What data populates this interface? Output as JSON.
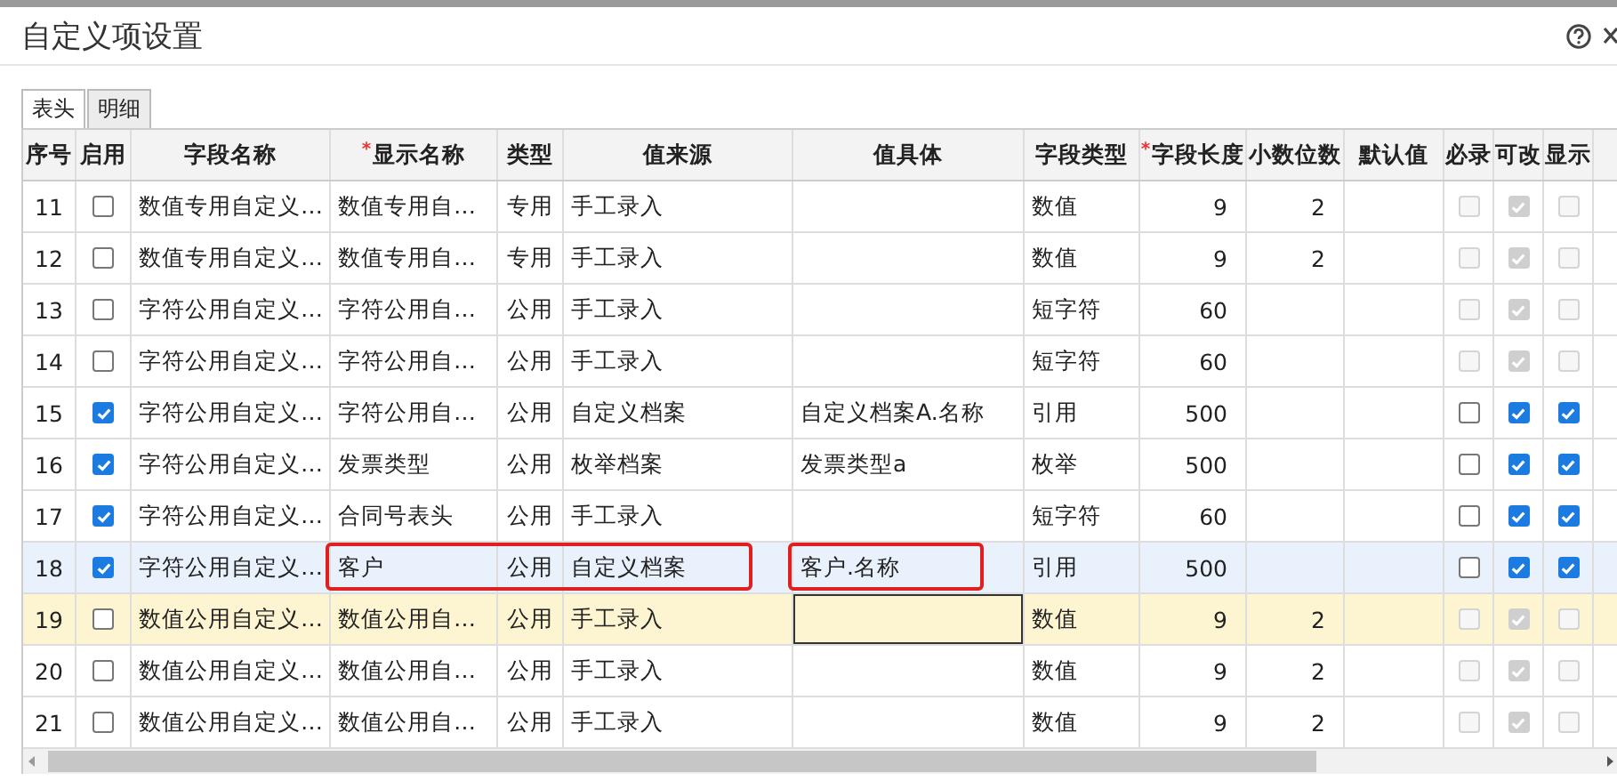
{
  "window": {
    "title": "自定义项设置"
  },
  "tabs": [
    {
      "label": "表头",
      "selected": true
    },
    {
      "label": "明细",
      "selected": false
    }
  ],
  "table": {
    "columns": [
      {
        "label": "序号"
      },
      {
        "label": "启用"
      },
      {
        "label": "字段名称"
      },
      {
        "label": "显示名称",
        "required_mark": "*"
      },
      {
        "label": "类型"
      },
      {
        "label": "值来源"
      },
      {
        "label": "值具体"
      },
      {
        "label": "字段类型"
      },
      {
        "label": "字段长度",
        "required_mark": "*"
      },
      {
        "label": "小数位数"
      },
      {
        "label": "默认值"
      },
      {
        "label": "必录"
      },
      {
        "label": "可改"
      },
      {
        "label": "显示"
      }
    ],
    "rows": [
      {
        "no": "11",
        "enabled": false,
        "field_name": "数值专用自定义…",
        "display_name": "数值专用自…",
        "type": "专用",
        "value_source": "手工录入",
        "field_type": "数值",
        "length": "9",
        "decimals": "2",
        "must": {
          "checked": false,
          "disabled": true
        },
        "editable": {
          "checked": true,
          "disabled": true
        },
        "visible": {
          "checked": false,
          "disabled": true
        },
        "selected": false,
        "editing": false
      },
      {
        "no": "12",
        "enabled": false,
        "field_name": "数值专用自定义…",
        "display_name": "数值专用自…",
        "type": "专用",
        "value_source": "手工录入",
        "field_type": "数值",
        "length": "9",
        "decimals": "2",
        "must": {
          "checked": false,
          "disabled": true
        },
        "editable": {
          "checked": true,
          "disabled": true
        },
        "visible": {
          "checked": false,
          "disabled": true
        },
        "selected": false,
        "editing": false
      },
      {
        "no": "13",
        "enabled": false,
        "field_name": "字符公用自定义…",
        "display_name": "字符公用自…",
        "type": "公用",
        "value_source": "手工录入",
        "field_type": "短字符",
        "length": "60",
        "must": {
          "checked": false,
          "disabled": true
        },
        "editable": {
          "checked": true,
          "disabled": true
        },
        "visible": {
          "checked": false,
          "disabled": true
        },
        "selected": false,
        "editing": false
      },
      {
        "no": "14",
        "enabled": false,
        "field_name": "字符公用自定义…",
        "display_name": "字符公用自…",
        "type": "公用",
        "value_source": "手工录入",
        "field_type": "短字符",
        "length": "60",
        "must": {
          "checked": false,
          "disabled": true
        },
        "editable": {
          "checked": true,
          "disabled": true
        },
        "visible": {
          "checked": false,
          "disabled": true
        },
        "selected": false,
        "editing": false
      },
      {
        "no": "15",
        "enabled": true,
        "field_name": "字符公用自定义…",
        "display_name": "字符公用自…",
        "type": "公用",
        "value_source": "自定义档案",
        "value_detail": "自定义档案A.名称",
        "field_type": "引用",
        "length": "500",
        "must": {
          "checked": false,
          "disabled": false
        },
        "editable": {
          "checked": true,
          "disabled": false
        },
        "visible": {
          "checked": true,
          "disabled": false
        },
        "selected": false,
        "editing": false
      },
      {
        "no": "16",
        "enabled": true,
        "field_name": "字符公用自定义…",
        "display_name": "发票类型",
        "type": "公用",
        "value_source": "枚举档案",
        "value_detail": "发票类型a",
        "field_type": "枚举",
        "length": "500",
        "must": {
          "checked": false,
          "disabled": false
        },
        "editable": {
          "checked": true,
          "disabled": false
        },
        "visible": {
          "checked": true,
          "disabled": false
        },
        "selected": false,
        "editing": false
      },
      {
        "no": "17",
        "enabled": true,
        "field_name": "字符公用自定义…",
        "display_name": "合同号表头",
        "type": "公用",
        "value_source": "手工录入",
        "field_type": "短字符",
        "length": "60",
        "must": {
          "checked": false,
          "disabled": false
        },
        "editable": {
          "checked": true,
          "disabled": false
        },
        "visible": {
          "checked": true,
          "disabled": false
        },
        "selected": false,
        "editing": false
      },
      {
        "no": "18",
        "enabled": true,
        "field_name": "字符公用自定义…",
        "display_name": "客户",
        "type": "公用",
        "value_source": "自定义档案",
        "value_detail": "客户.名称",
        "field_type": "引用",
        "length": "500",
        "must": {
          "checked": false,
          "disabled": false
        },
        "editable": {
          "checked": true,
          "disabled": false
        },
        "visible": {
          "checked": true,
          "disabled": false
        },
        "selected": true,
        "editing": false,
        "source_framed": true,
        "detail_framed": true
      },
      {
        "no": "19",
        "enabled": false,
        "field_name": "数值公用自定义…",
        "display_name": "数值公用自…",
        "type": "公用",
        "value_source": "手工录入",
        "field_type": "数值",
        "length": "9",
        "decimals": "2",
        "must": {
          "checked": false,
          "disabled": true
        },
        "editable": {
          "checked": true,
          "disabled": true
        },
        "visible": {
          "checked": false,
          "disabled": true
        },
        "selected": false,
        "editing": true
      },
      {
        "no": "20",
        "enabled": false,
        "field_name": "数值公用自定义…",
        "display_name": "数值公用自…",
        "type": "公用",
        "value_source": "手工录入",
        "field_type": "数值",
        "length": "9",
        "decimals": "2",
        "must": {
          "checked": false,
          "disabled": true
        },
        "editable": {
          "checked": true,
          "disabled": true
        },
        "visible": {
          "checked": false,
          "disabled": true
        },
        "selected": false,
        "editing": false
      },
      {
        "no": "21",
        "enabled": false,
        "field_name": "数值公用自定义…",
        "display_name": "数值公用自…",
        "type": "公用",
        "value_source": "手工录入",
        "field_type": "数值",
        "length": "9",
        "decimals": "2",
        "must": {
          "checked": false,
          "disabled": true
        },
        "editable": {
          "checked": true,
          "disabled": true
        },
        "visible": {
          "checked": false,
          "disabled": true
        },
        "selected": false,
        "editing": false
      }
    ]
  }
}
